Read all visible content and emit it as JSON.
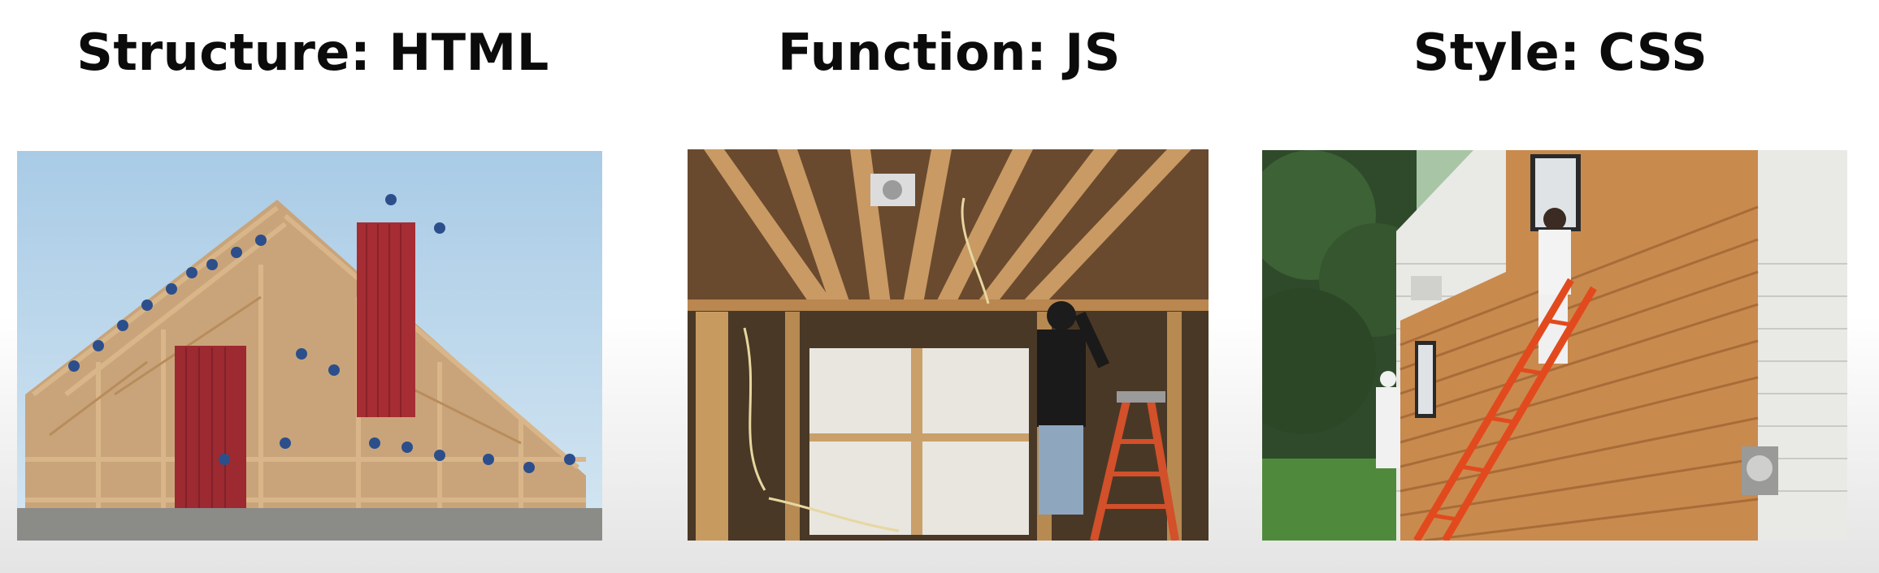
{
  "headings": {
    "structure": "Structure: HTML",
    "function": "Function: JS",
    "style": "Style: CSS"
  },
  "photos": [
    {
      "id": "barn-raising-photo"
    },
    {
      "id": "electrical-wiring-photo"
    },
    {
      "id": "house-painting-photo"
    }
  ]
}
